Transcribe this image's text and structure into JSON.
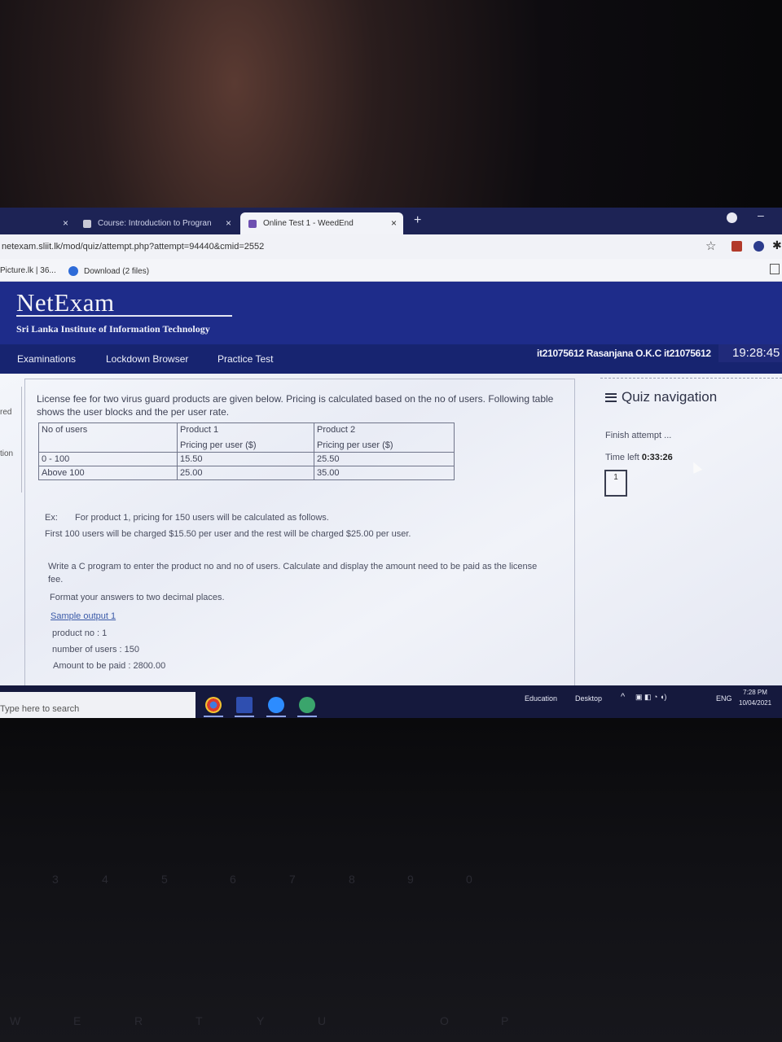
{
  "browser": {
    "tabs": [
      {
        "label": "",
        "active": false
      },
      {
        "label": "Course: Introduction to Progran",
        "active": false
      },
      {
        "label": "Online Test 1 - WeedEnd",
        "active": true
      }
    ],
    "new_tab": "+",
    "minimize": "–",
    "url": "netexam.sliit.lk/mod/quiz/attempt.php?attempt=94440&cmid=2552",
    "star": "☆",
    "bookmarks": [
      "Picture.lk | 36...",
      "Download (2 files)"
    ]
  },
  "site": {
    "logo": "NetExam",
    "institute": "Sri Lanka Institute of Information Technology",
    "nav": [
      "Examinations",
      "Lockdown Browser",
      "Practice Test"
    ],
    "user": "it21075612 Rasanjana O.K.C it21075612",
    "clock": "19:28:45"
  },
  "left_stub": [
    "red",
    "tion"
  ],
  "question": {
    "intro": "License fee for two virus guard products are given below. Pricing is calculated based on the no of users. Following table shows the user blocks and the per user rate.",
    "table": {
      "headers": [
        "No of users",
        "Product 1",
        "Product 2"
      ],
      "subheaders": [
        "",
        "Pricing per user ($)",
        "Pricing per user ($)"
      ],
      "rows": [
        [
          "0 - 100",
          "15.50",
          "25.50"
        ],
        [
          "Above 100",
          "25.00",
          "35.00"
        ]
      ]
    },
    "example_label": "Ex:",
    "example_line1": "For product 1, pricing for 150 users will be calculated as follows.",
    "example_line2": "First 100 users will be charged $15.50 per user and the rest will be charged $25.00 per user.",
    "task": "Write a C program to enter the product no and  no of users. Calculate and display the amount need to be paid as the license fee.",
    "format_note": "Format your answers to two decimal places.",
    "sample_link": "Sample output 1",
    "sample_lines": [
      "product no : 1",
      "number of users :  150",
      "Amount to be paid : 2800.00"
    ]
  },
  "quiz_nav": {
    "title": "Quiz navigation",
    "finish": "Finish attempt ...",
    "time_label": "Time left",
    "time_value": "0:33:26",
    "question_no": "1"
  },
  "taskbar": {
    "search": "Type here to search",
    "education": "Education",
    "desktop": "Desktop",
    "lang": "ENG",
    "time": "7:28 PM",
    "date": "10/04/2021"
  },
  "colors": {
    "header_blue": "#1e2c8a",
    "nav_blue": "#172470",
    "tab_strip": "#1d2355",
    "link": "#3b5aa8"
  }
}
